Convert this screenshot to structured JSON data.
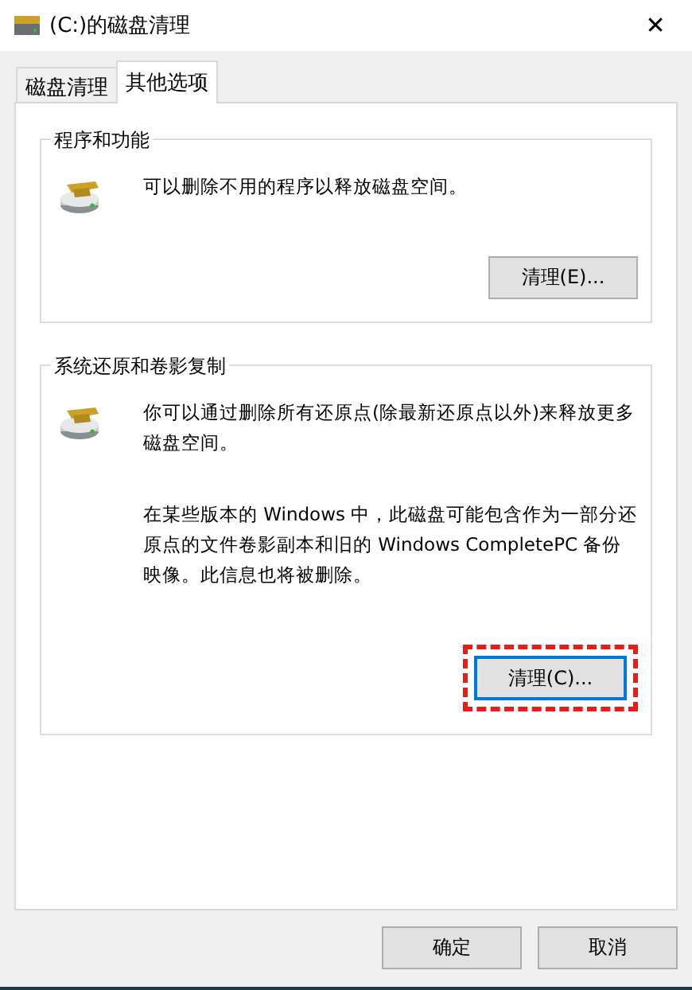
{
  "window": {
    "title": "(C:)的磁盘清理",
    "close": "✕"
  },
  "tabs": [
    {
      "label": "磁盘清理",
      "selected": false
    },
    {
      "label": "其他选项",
      "selected": true
    }
  ],
  "groups": [
    {
      "title": "程序和功能",
      "paragraphs": [
        "可以删除不用的程序以释放磁盘空间。"
      ],
      "button": {
        "label": "清理(E)...",
        "focused": false,
        "highlighted": false
      }
    },
    {
      "title": "系统还原和卷影复制",
      "paragraphs": [
        "你可以通过删除所有还原点(除最新还原点以外)来释放更多磁盘空间。",
        "在某些版本的 Windows 中，此磁盘可能包含作为一部分还原点的文件卷影副本和旧的 Windows CompletePC 备份映像。此信息也将被删除。"
      ],
      "button": {
        "label": "清理(C)...",
        "focused": true,
        "highlighted": true
      }
    }
  ],
  "buttons": [
    "确定",
    "取消"
  ]
}
